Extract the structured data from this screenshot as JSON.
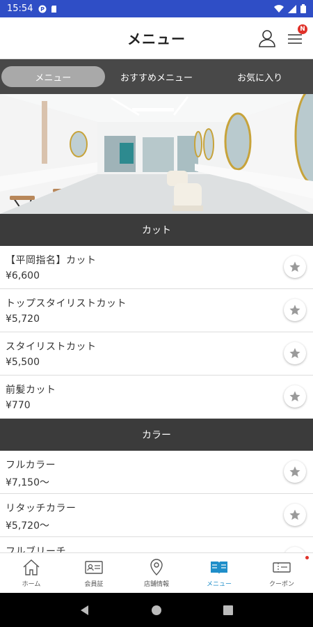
{
  "status_bar": {
    "time": "15:54"
  },
  "header": {
    "title": "メニュー",
    "badge": "N"
  },
  "tabs": [
    {
      "label": "メニュー",
      "active": true
    },
    {
      "label": "おすすめメニュー",
      "active": false
    },
    {
      "label": "お気に入り",
      "active": false
    }
  ],
  "sections": [
    {
      "title": "カット",
      "items": [
        {
          "name": "【平岡指名】カット",
          "price": "¥6,600"
        },
        {
          "name": "トップスタイリストカット",
          "price": "¥5,720"
        },
        {
          "name": "スタイリストカット",
          "price": "¥5,500"
        },
        {
          "name": "前髪カット",
          "price": "¥770"
        }
      ]
    },
    {
      "title": "カラー",
      "items": [
        {
          "name": "フルカラー",
          "price": "¥7,150〜"
        },
        {
          "name": "リタッチカラー",
          "price": "¥5,720〜"
        },
        {
          "name": "フルブリーチ",
          "price": ""
        }
      ]
    }
  ],
  "bottom_nav": [
    {
      "label": "ホーム",
      "icon": "home-icon"
    },
    {
      "label": "会員証",
      "icon": "member-card-icon"
    },
    {
      "label": "店舗情報",
      "icon": "location-pin-icon"
    },
    {
      "label": "メニュー",
      "icon": "menu-book-icon",
      "active": true
    },
    {
      "label": "クーポン",
      "icon": "coupon-icon"
    }
  ],
  "colors": {
    "status_bar": "#2f4ec6",
    "tab_bar": "#484848",
    "section_header": "#3b3b3b",
    "active_nav": "#1f8ec9",
    "badge": "#e0322a"
  }
}
